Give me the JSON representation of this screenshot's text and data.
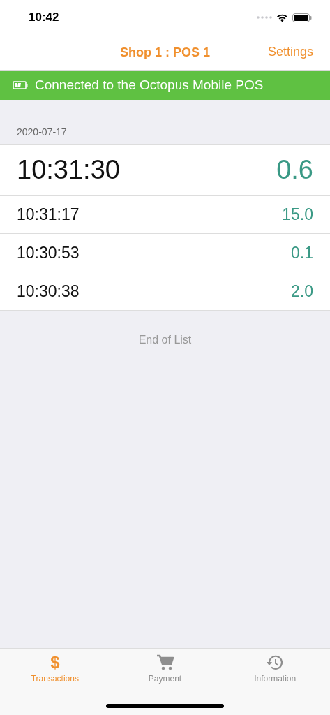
{
  "status_bar": {
    "time": "10:42"
  },
  "nav": {
    "title": "Shop 1 : POS 1",
    "action": "Settings"
  },
  "banner": {
    "text": "Connected to the Octopus Mobile POS"
  },
  "section": {
    "date": "2020-07-17"
  },
  "transactions": [
    {
      "time": "10:31:30",
      "amount": "0.6",
      "latest": true
    },
    {
      "time": "10:31:17",
      "amount": "15.0",
      "latest": false
    },
    {
      "time": "10:30:53",
      "amount": "0.1",
      "latest": false
    },
    {
      "time": "10:30:38",
      "amount": "2.0",
      "latest": false
    }
  ],
  "footer_note": "End of List",
  "tabs": [
    {
      "kind": "dollar",
      "glyph": "$",
      "label": "Transactions",
      "selected": true
    },
    {
      "kind": "cart",
      "label": "Payment",
      "selected": false
    },
    {
      "kind": "history",
      "label": "Information",
      "selected": false
    }
  ]
}
